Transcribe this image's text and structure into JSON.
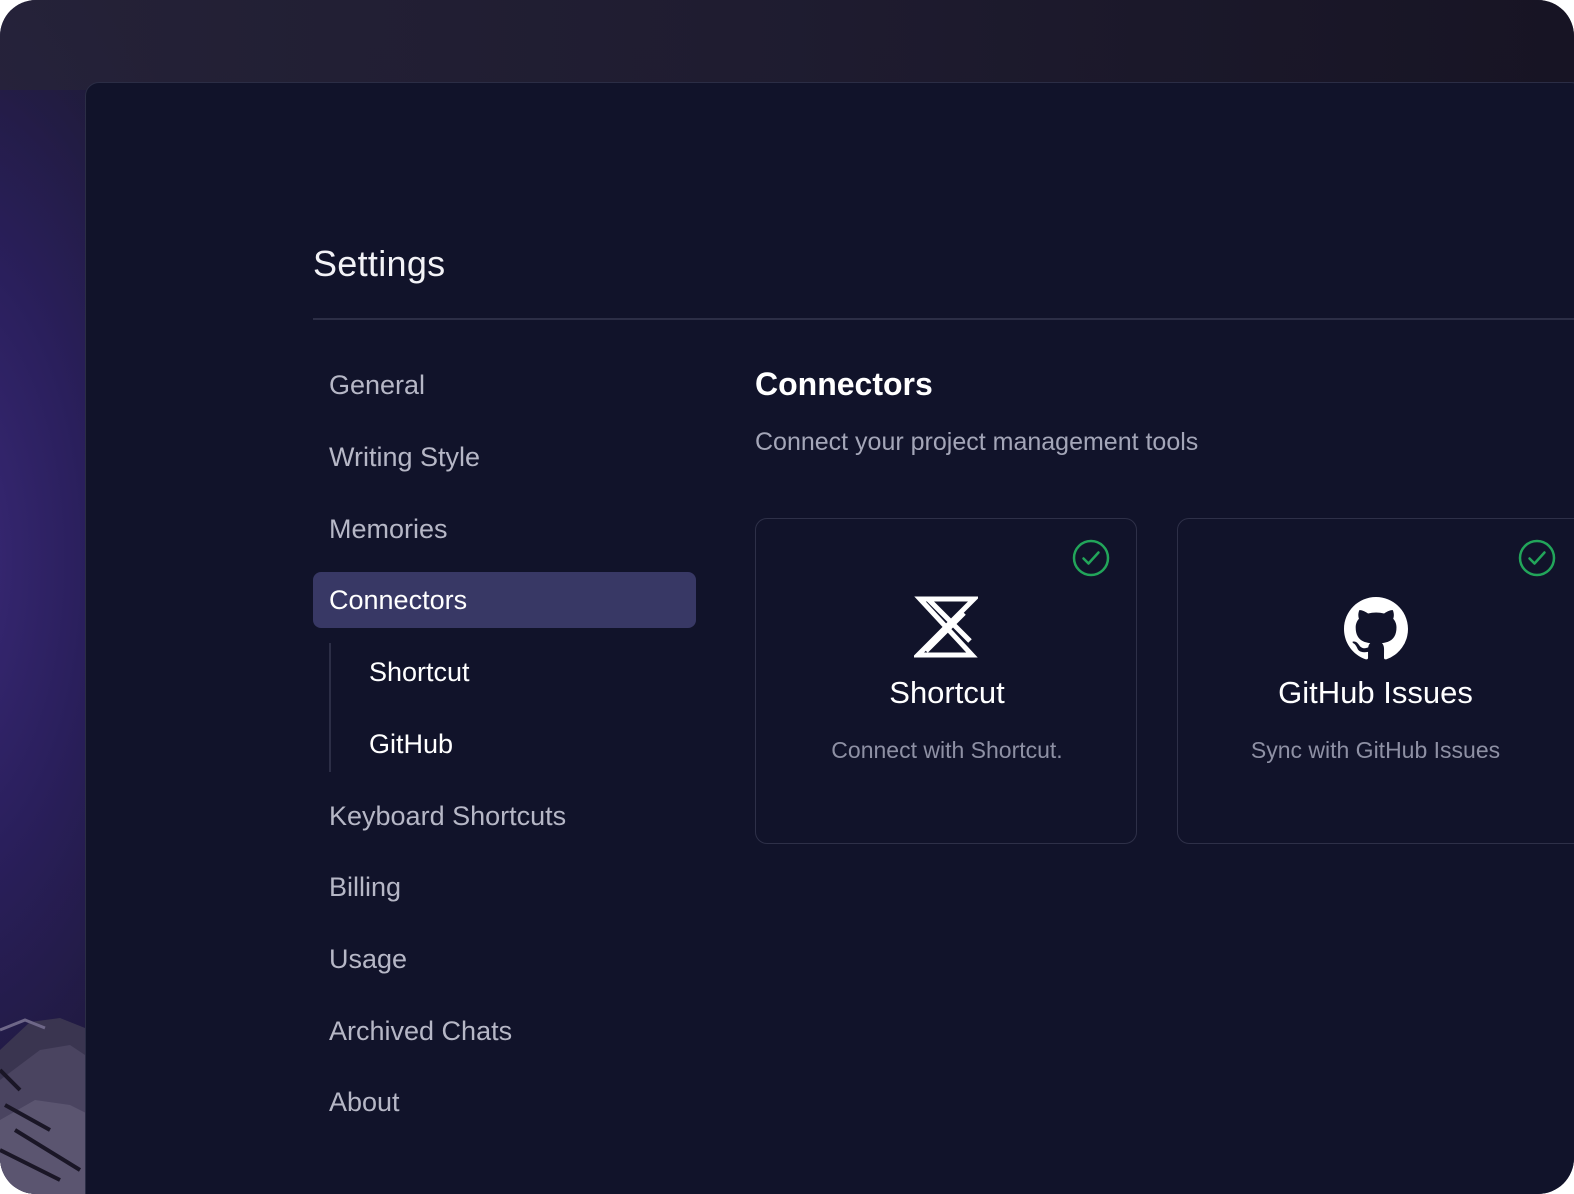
{
  "header": {
    "title": "Settings"
  },
  "sidebar": {
    "items": [
      {
        "label": "General"
      },
      {
        "label": "Writing Style"
      },
      {
        "label": "Memories"
      },
      {
        "label": "Connectors",
        "active": true
      },
      {
        "label": "Keyboard Shortcuts"
      },
      {
        "label": "Billing"
      },
      {
        "label": "Usage"
      },
      {
        "label": "Archived Chats"
      },
      {
        "label": "About"
      }
    ],
    "sub_items": [
      {
        "label": "Shortcut"
      },
      {
        "label": "GitHub"
      }
    ]
  },
  "main": {
    "title": "Connectors",
    "subtitle": "Connect your project management tools",
    "cards": [
      {
        "name": "Shortcut",
        "description": "Connect with Shortcut.",
        "icon": "shortcut-logo-icon",
        "connected": true
      },
      {
        "name": "GitHub Issues",
        "description": "Sync with GitHub Issues",
        "icon": "github-logo-icon",
        "connected": true
      }
    ]
  },
  "colors": {
    "background": "#11132a",
    "active_nav": "#383865",
    "success": "#22a55a",
    "text_primary": "#ffffff",
    "text_muted": "#b6b7c6"
  }
}
